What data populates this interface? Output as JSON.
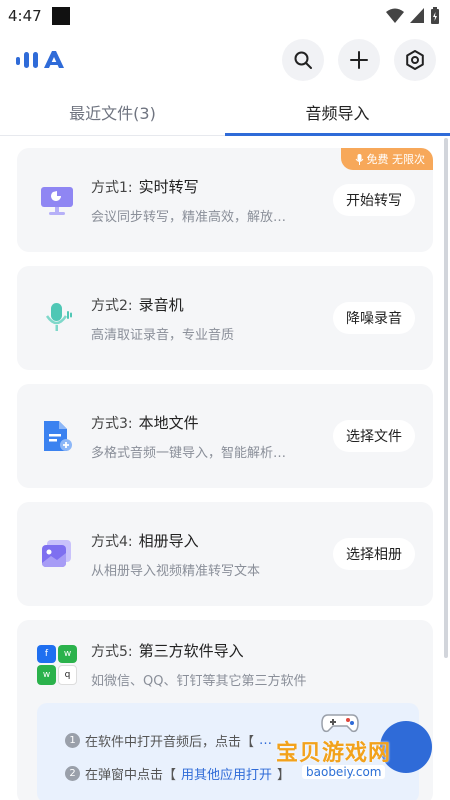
{
  "status": {
    "time": "4:47"
  },
  "tabs": [
    {
      "label": "最近文件(3)",
      "active": false
    },
    {
      "label": "音频导入",
      "active": true
    }
  ],
  "badge": {
    "label": "免费 无限次"
  },
  "methods": [
    {
      "prefix": "方式1:",
      "title": "实时转写",
      "desc": "会议同步转写，精准高效，解放…",
      "button": "开始转写",
      "icon": "screen-icon"
    },
    {
      "prefix": "方式2:",
      "title": "录音机",
      "desc": "高清取证录音，专业音质",
      "button": "降噪录音",
      "icon": "microphone-icon"
    },
    {
      "prefix": "方式3:",
      "title": "本地文件",
      "desc": "多格式音频一键导入，智能解析…",
      "button": "选择文件",
      "icon": "file-add-icon"
    },
    {
      "prefix": "方式4:",
      "title": "相册导入",
      "desc": "从相册导入视频精准转写文本",
      "button": "选择相册",
      "icon": "album-icon"
    },
    {
      "prefix": "方式5:",
      "title": "第三方软件导入",
      "desc": "如微信、QQ、钉钉等其它第三方软件",
      "icon": "third-party-apps-icon"
    }
  ],
  "guide": {
    "step1_num": "1",
    "step1_text": "在软件中打开音频后，点击【",
    "step1_hl": "…",
    "step2_num": "2",
    "step2_text": "在弹窗中点击【",
    "step2_hl": "用其他应用打开",
    "step2_end": "】"
  },
  "watermark": {
    "text": "宝贝游戏网",
    "url": "baobeiy.com"
  },
  "colors": {
    "accent": "#2f6bd8",
    "badge": "#f7a85a",
    "card": "#f5f6f8"
  }
}
